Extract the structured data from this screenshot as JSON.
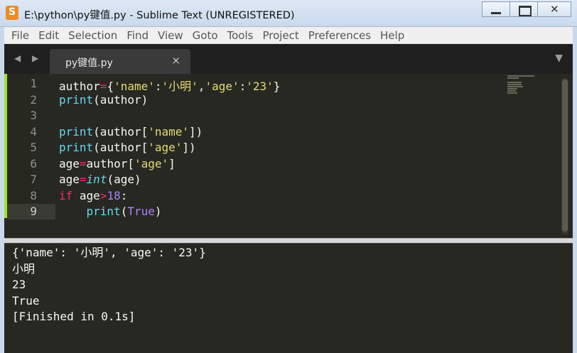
{
  "window": {
    "title": "E:\\python\\py键值.py - Sublime Text (UNREGISTERED)"
  },
  "menu": [
    "File",
    "Edit",
    "Selection",
    "Find",
    "View",
    "Goto",
    "Tools",
    "Project",
    "Preferences",
    "Help"
  ],
  "tabs": {
    "nav_arrows": "◀ ▶",
    "active_label": "py键值.py",
    "close_glyph": "×",
    "dropdown_glyph": "▼"
  },
  "editor": {
    "current_line": 9,
    "lines": [
      {
        "num": "1",
        "tokens": [
          [
            "",
            "author"
          ],
          [
            "op",
            "="
          ],
          [
            "",
            "{"
          ],
          [
            "str",
            "'name'"
          ],
          [
            "",
            ":"
          ],
          [
            "str",
            "'小明'"
          ],
          [
            "",
            ","
          ],
          [
            "str",
            "'age'"
          ],
          [
            "",
            ":"
          ],
          [
            "str",
            "'23'"
          ],
          [
            "",
            "}"
          ]
        ]
      },
      {
        "num": "2",
        "tokens": [
          [
            "fn",
            "print"
          ],
          [
            "",
            "(author)"
          ]
        ]
      },
      {
        "num": "3",
        "tokens": []
      },
      {
        "num": "4",
        "tokens": [
          [
            "fn",
            "print"
          ],
          [
            "",
            "(author["
          ],
          [
            "str",
            "'name'"
          ],
          [
            "",
            "])"
          ]
        ]
      },
      {
        "num": "5",
        "tokens": [
          [
            "fn",
            "print"
          ],
          [
            "",
            "(author["
          ],
          [
            "str",
            "'age'"
          ],
          [
            "",
            "])"
          ]
        ]
      },
      {
        "num": "6",
        "tokens": [
          [
            "",
            "age"
          ],
          [
            "op",
            "="
          ],
          [
            "",
            "author["
          ],
          [
            "str",
            "'age'"
          ],
          [
            "",
            "]"
          ]
        ]
      },
      {
        "num": "7",
        "tokens": [
          [
            "",
            "age"
          ],
          [
            "op",
            "="
          ],
          [
            "type",
            "int"
          ],
          [
            "",
            "(age)"
          ]
        ]
      },
      {
        "num": "8",
        "tokens": [
          [
            "kw",
            "if"
          ],
          [
            "",
            " age"
          ],
          [
            "op",
            ">"
          ],
          [
            "num",
            "18"
          ],
          [
            "",
            ":"
          ]
        ]
      },
      {
        "num": "9",
        "tokens": [
          [
            "",
            "    "
          ],
          [
            "fn",
            "print"
          ],
          [
            "",
            "("
          ],
          [
            "const",
            "True"
          ],
          [
            "",
            ")"
          ]
        ]
      }
    ]
  },
  "output": {
    "lines": [
      "{'name': '小明', 'age': '23'}",
      "小明",
      "23",
      "True",
      "[Finished in 0.1s]"
    ]
  },
  "colors": {
    "editor_bg": "#272822",
    "string": "#e6db74",
    "keyword": "#f92672",
    "function": "#66d9ef",
    "number": "#ae81ff"
  }
}
